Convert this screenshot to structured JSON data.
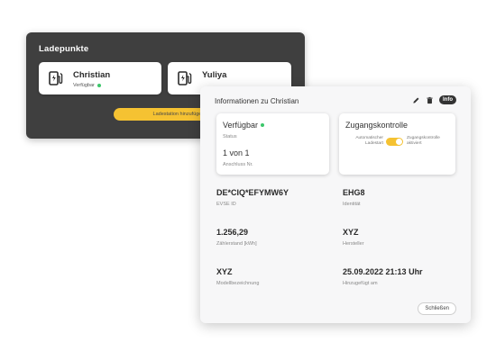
{
  "back_panel": {
    "title": "Ladepunkte",
    "cards": [
      {
        "name": "Christian",
        "status": "Verfügbar",
        "status_color": "#3cc66a",
        "icon": "charger-icon"
      },
      {
        "name": "Yuliya",
        "icon": "charger-icon"
      }
    ],
    "add_button_label": "Ladestation hinzufügen"
  },
  "info_panel": {
    "title": "Informationen zu Christian",
    "edit_icon": "pencil-icon",
    "delete_icon": "trash-icon",
    "info_badge": "Info",
    "availability": {
      "value": "Verfügbar",
      "label": "Status",
      "dot_color": "#3cc66a",
      "connector_value": "1 von 1",
      "connector_label": "Anschluss Nr."
    },
    "access_control": {
      "title": "Zugangskontrolle",
      "left_option": "Automatischer Ladestart",
      "right_option": "Zugangskontrolle aktiviert",
      "toggle_on": true,
      "accent_color": "#f5c232"
    },
    "fields": [
      {
        "value": "DE*CIQ*EFYMW6Y",
        "label": "EVSE ID"
      },
      {
        "value": "EHG8",
        "label": "Identität"
      },
      {
        "value": "1.256,29",
        "label": "Zählerstand [kWh]"
      },
      {
        "value": "XYZ",
        "label": "Hersteller"
      },
      {
        "value": "XYZ",
        "label": "Modellbezeichnung"
      },
      {
        "value": "25.09.2022 21:13 Uhr",
        "label": "Hinzugefügt am"
      }
    ],
    "close_button_label": "Schließen"
  }
}
